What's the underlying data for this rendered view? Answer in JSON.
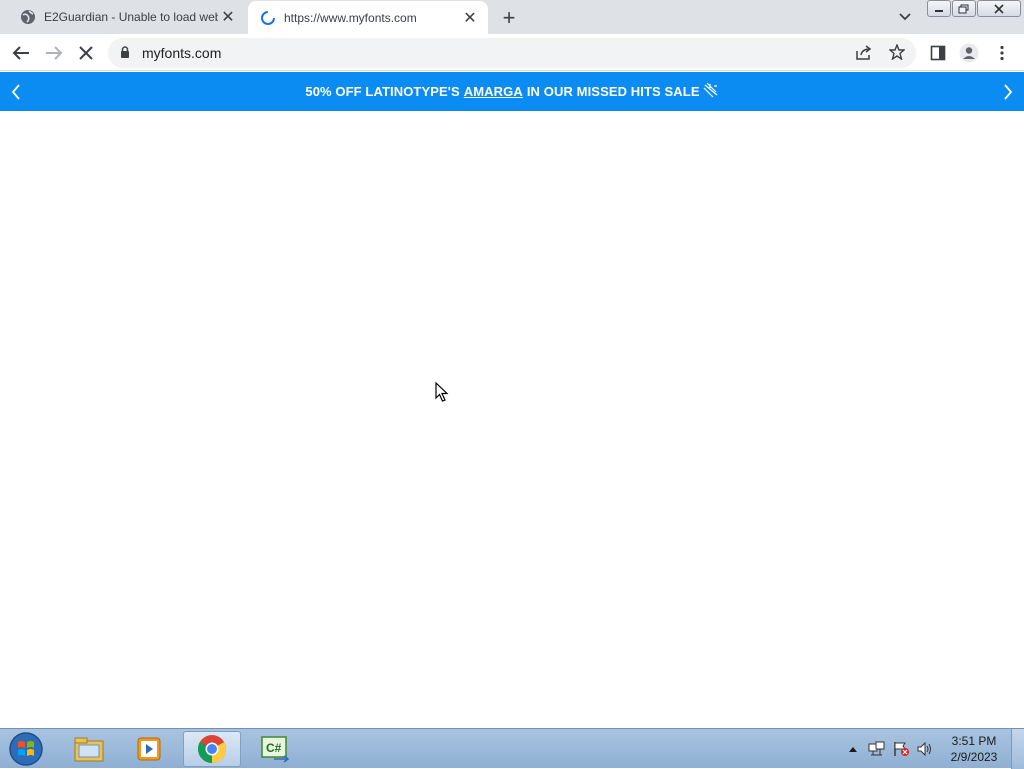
{
  "browser": {
    "tabs": [
      {
        "title": "E2Guardian - Unable to load web",
        "favicon": "globe-icon",
        "active": false
      },
      {
        "title": "https://www.myfonts.com",
        "favicon": "loading-spinner-icon",
        "active": true
      }
    ],
    "omnibox": {
      "url": "myfonts.com"
    }
  },
  "banner": {
    "text_before": "50% OFF LATINOTYPE'S",
    "link_text": "AMARGA",
    "text_after": "IN OUR MISSED HITS SALE",
    "background": "#0b8cf2"
  },
  "taskbar": {
    "clock_time": "3:51 PM",
    "clock_date": "2/9/2023",
    "apps": [
      "windows-explorer-icon",
      "media-player-icon",
      "chrome-icon",
      "csharp-icon"
    ]
  }
}
